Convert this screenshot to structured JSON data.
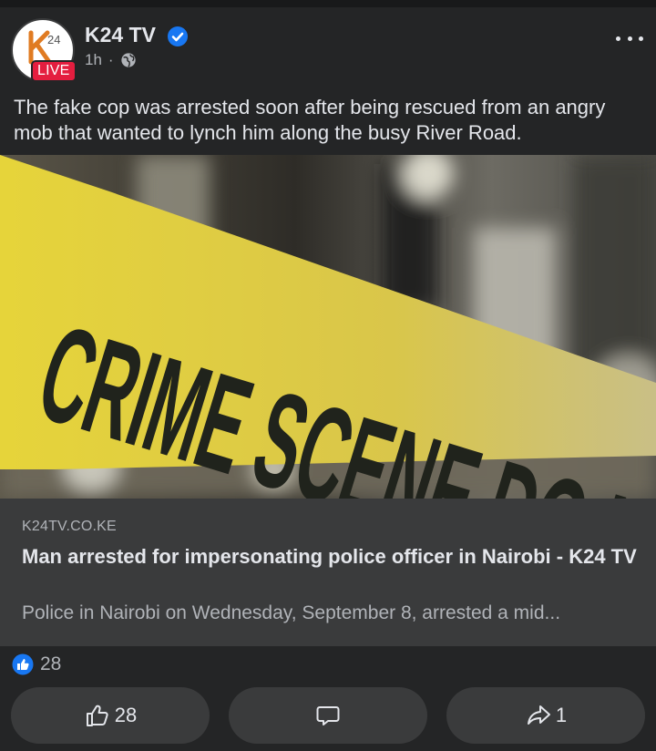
{
  "post": {
    "page_name": "K24 TV",
    "verified_icon": "verified-badge-icon",
    "time": "1h",
    "separator": "·",
    "audience_icon": "globe-icon",
    "live_badge": "LIVE",
    "avatar_text": "24",
    "caption": "The fake cop was arrested soon after being rescued from an angry mob that wanted to lynch him along the busy River Road.",
    "image_text": "CRIME SCENE DO NOT CROSS"
  },
  "link_preview": {
    "domain": "K24TV.CO.KE",
    "title": "Man arrested for impersonating police officer in Nairobi - K24 TV",
    "description": "Police in Nairobi on Wednesday, September 8, arrested a mid..."
  },
  "reactions": {
    "icon": "like-reaction-icon",
    "count": "28"
  },
  "actions": [
    {
      "icon": "thumbs-up-icon",
      "label": "28"
    },
    {
      "icon": "comment-icon",
      "label": ""
    },
    {
      "icon": "share-icon",
      "label": "1"
    }
  ],
  "colors": {
    "background": "#242526",
    "card": "#3a3b3c",
    "primary_text": "#e4e6eb",
    "secondary_text": "#b0b3b8",
    "verified_blue": "#1877f2",
    "live_red": "#e41e3f",
    "tape_yellow": "#e8d632"
  }
}
